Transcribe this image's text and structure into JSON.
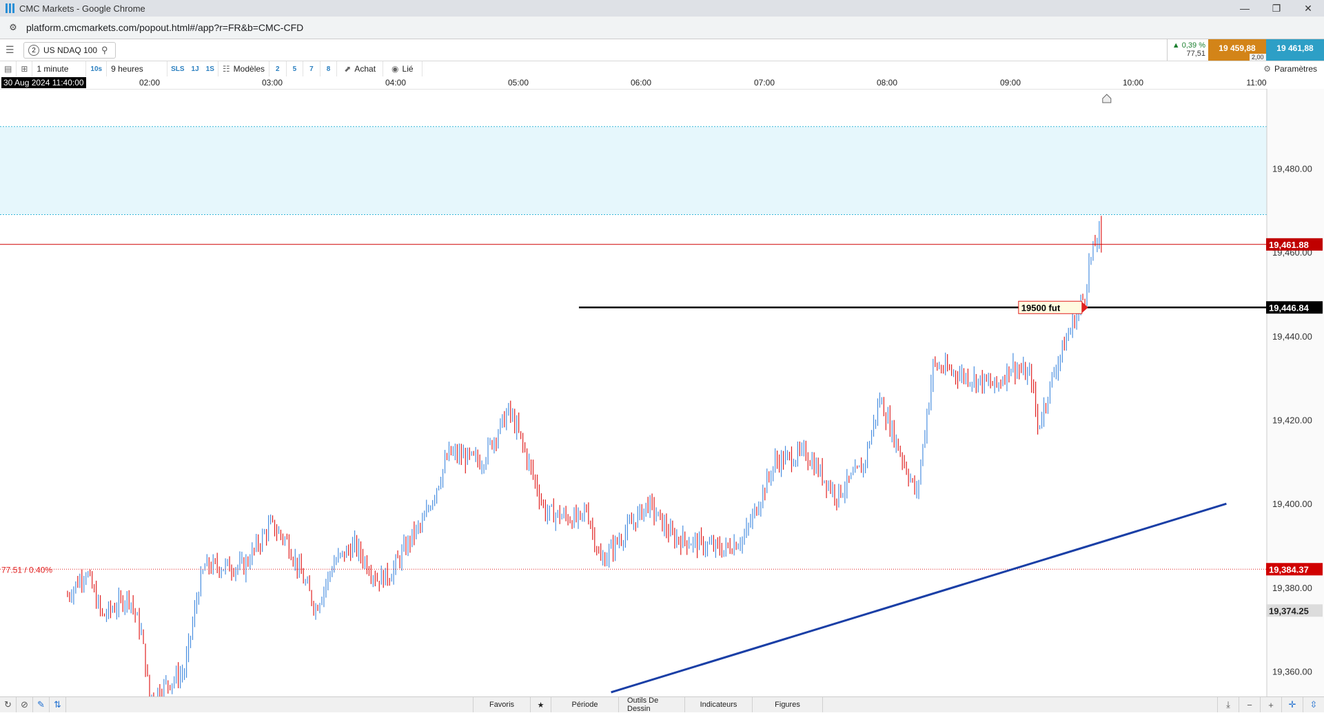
{
  "window": {
    "title": "CMC Markets - Google Chrome",
    "minimize": "—",
    "restore": "❐",
    "close": "✕"
  },
  "browser": {
    "url": "platform.cmcmarkets.com/popout.html#/app?r=FR&b=CMC-CFD"
  },
  "instrument": {
    "badge": "2",
    "name": "US NDAQ 100"
  },
  "quote": {
    "change_pct": "▲ 0,39 %",
    "change_pts": "77,51",
    "sell": "19 459,88",
    "buy": "19 461,88",
    "spread": "2,00"
  },
  "toolbar": {
    "interval": "1 minute",
    "tf_10s": "10s",
    "range": "9 heures",
    "sls": "SLS",
    "d1": "1J",
    "s1": "1S",
    "models": "Modèles",
    "n2": "2",
    "n5": "5",
    "n7": "7",
    "n8": "8",
    "buy": "Achat",
    "linked": "Lié",
    "params": "Paramètres"
  },
  "time_axis": {
    "cursor": "30 Aug 2024 11:40:00",
    "ticks": [
      "02:00",
      "03:00",
      "04:00",
      "05:00",
      "06:00",
      "07:00",
      "08:00",
      "09:00",
      "10:00",
      "11:00"
    ]
  },
  "chart_data": {
    "type": "candlestick",
    "instrument": "US NDAQ 100",
    "interval": "1 minute",
    "x_ticks": [
      "02:00",
      "03:00",
      "04:00",
      "05:00",
      "06:00",
      "07:00",
      "08:00",
      "09:00",
      "10:00",
      "11:00"
    ],
    "y_ticks": [
      "19,360.00",
      "19,380.00",
      "19,400.00",
      "19,420.00",
      "19,440.00",
      "19,460.00",
      "19,480.00"
    ],
    "y_tick_values": [
      19360,
      19380,
      19400,
      19420,
      19440,
      19460,
      19480
    ],
    "ylim": [
      19354,
      19499
    ],
    "current_price": 19461.88,
    "current_price_label": "19,461.88",
    "prev_close_price": 19384.37,
    "prev_close_label": "19,384.37",
    "prev_change_label": "77.51 / 0.40%",
    "marker_price_label": "19,374.25",
    "horizontal_line": {
      "price": 19446.84,
      "label": "19,446.84",
      "note": "19500 fut"
    },
    "zone": {
      "from": 19469,
      "to": 19490
    },
    "trendline": {
      "from": [
        "05:45",
        19355
      ],
      "to": [
        "10:45",
        19400
      ]
    },
    "colors": {
      "up": "#4a8fe0",
      "down": "#e02020",
      "zone": "#e6f7fc",
      "trendline": "#1a3fa6",
      "current": "#c00000"
    },
    "ohlc_anchor_points": [
      [
        "01:20",
        19378
      ],
      [
        "01:29",
        19384
      ],
      [
        "01:37",
        19373
      ],
      [
        "01:50",
        19378
      ],
      [
        "01:56",
        19369
      ],
      [
        "02:00",
        19354
      ],
      [
        "02:17",
        19360
      ],
      [
        "02:24",
        19380
      ],
      [
        "02:27",
        19385
      ],
      [
        "02:46",
        19385
      ],
      [
        "02:59",
        19395
      ],
      [
        "03:07",
        19391
      ],
      [
        "03:21",
        19375
      ],
      [
        "03:30",
        19386
      ],
      [
        "03:40",
        19390
      ],
      [
        "03:51",
        19382
      ],
      [
        "03:57",
        19383
      ],
      [
        "04:09",
        19393
      ],
      [
        "04:13",
        19395
      ],
      [
        "04:26",
        19412
      ],
      [
        "04:42",
        19410
      ],
      [
        "04:45",
        19413
      ],
      [
        "04:55",
        19422
      ],
      [
        "04:59",
        19418
      ],
      [
        "05:13",
        19398
      ],
      [
        "05:30",
        19396
      ],
      [
        "05:33",
        19399
      ],
      [
        "05:40",
        19386
      ],
      [
        "06:03",
        19400
      ],
      [
        "06:15",
        19392
      ],
      [
        "06:40",
        19389
      ],
      [
        "06:50",
        19392
      ],
      [
        "07:05",
        19410
      ],
      [
        "07:20",
        19412
      ],
      [
        "07:35",
        19402
      ],
      [
        "07:48",
        19409
      ],
      [
        "07:56",
        19425
      ],
      [
        "08:14",
        19402
      ],
      [
        "08:22",
        19433
      ],
      [
        "08:53",
        19428
      ],
      [
        "09:00",
        19433
      ],
      [
        "09:10",
        19430
      ],
      [
        "09:13",
        19418
      ],
      [
        "09:22",
        19433
      ],
      [
        "09:30",
        19443
      ],
      [
        "09:36",
        19450
      ],
      [
        "09:38",
        19457
      ],
      [
        "09:43",
        19465
      ],
      [
        "09:44",
        19461.88
      ]
    ]
  },
  "bottom": {
    "favorites": "Favoris",
    "period": "Période",
    "drawing": "Outils De Dessin",
    "indicators": "Indicateurs",
    "figures": "Figures"
  }
}
